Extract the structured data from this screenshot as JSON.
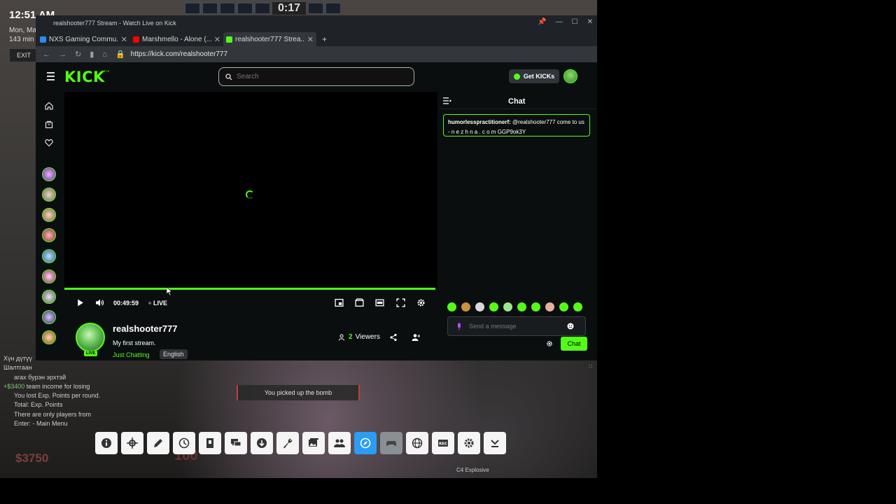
{
  "desktop": {
    "clock": "12:51 AM",
    "date_line1": "Mon, Ma",
    "date_line2": "143 min",
    "exit_label": "EXIT",
    "round_timer": "0:17"
  },
  "browser": {
    "window_title": "realshooter777 Stream - Watch Live on Kick",
    "tabs": [
      {
        "label": "NXS Gaming Commu...",
        "favicon_color": "#2a8cf0"
      },
      {
        "label": "Marshmello - Alone (...",
        "favicon_color": "#ff0000"
      },
      {
        "label": "realshooter777 Strea...",
        "favicon_color": "#53fc18"
      }
    ],
    "new_tab_label": "+",
    "url": "https://kick.com/realshooter777"
  },
  "kick": {
    "logo": "KICK",
    "logo_badge": "BETA",
    "search_placeholder": "Search",
    "get_kicks_label": "Get KICKs",
    "accent_color": "#53fc18",
    "player": {
      "time": "00:49:59",
      "live_label": "LIVE",
      "progress": 0.995
    },
    "channel": {
      "name": "realshooter777",
      "title": "My first stream.",
      "category": "Just Chatting",
      "language": "English",
      "live_badge": "LIVE",
      "viewers_count": "2",
      "viewers_label": "Viewers"
    },
    "chat": {
      "title": "Chat",
      "messages": [
        {
          "user": "humorlesspractitionerf:",
          "text": " @realshooter777 come to us - n e z h n a . c o m GGP9ok3Y"
        }
      ],
      "input_placeholder": "Send a message",
      "send_label": "Chat"
    }
  },
  "game": {
    "killfeed": [
      {
        "text": "агах бурэн эрхтэй"
      },
      {
        "prefix": "+$3400",
        "text": " team income for losing"
      },
      {
        "text": "You lost    Exp. Points per round."
      },
      {
        "text": "Total:       Exp. Points"
      },
      {
        "text": "There are only    players from"
      },
      {
        "text": "Enter:      - Main Menu"
      }
    ],
    "killfeed_top": "Хүн дүтүү",
    "killfeed_top2": "Шалтгаан",
    "center_message": "You picked up the bomb",
    "money": "$3750",
    "health": "100",
    "weapon_label": "C4 Explosive"
  }
}
